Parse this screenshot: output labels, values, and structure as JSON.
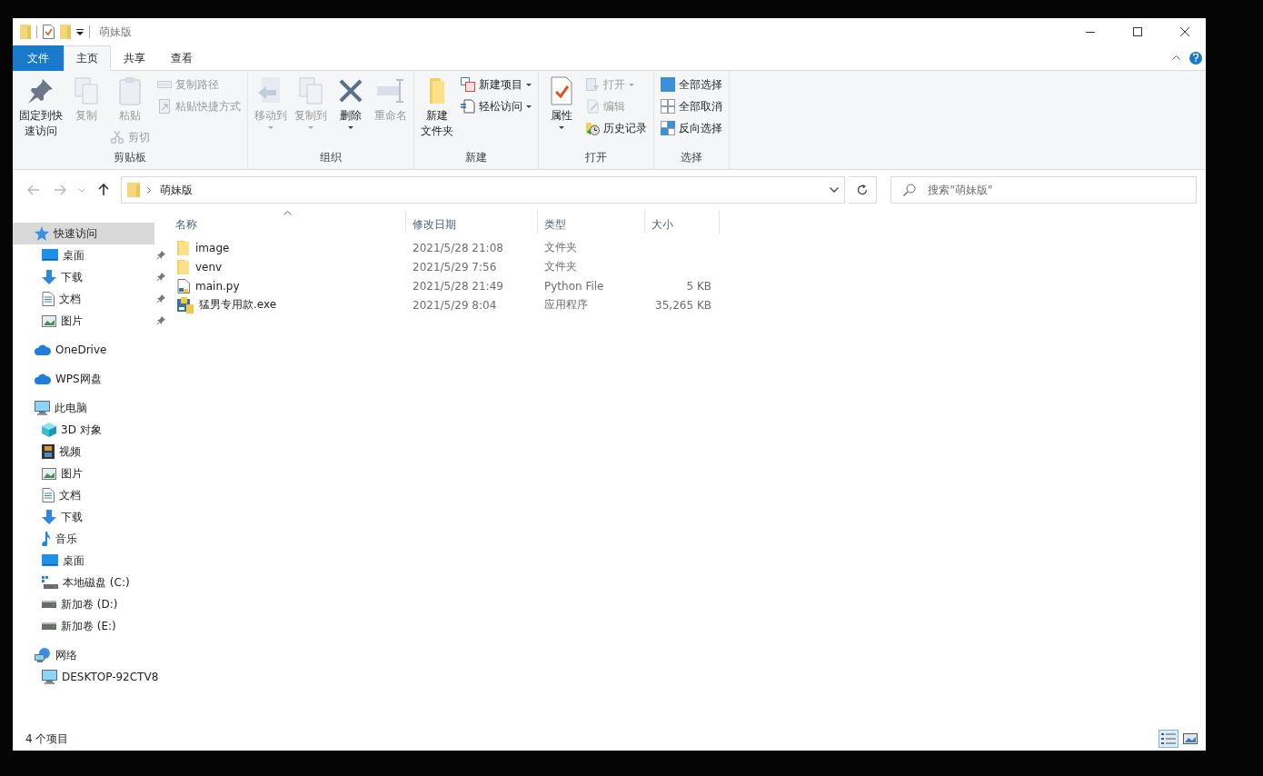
{
  "title_bar": {
    "title": "萌妹版"
  },
  "ribbon": {
    "tabs": [
      {
        "label": "文件",
        "kind": "file",
        "selected": false
      },
      {
        "label": "主页",
        "kind": "tab",
        "selected": true
      },
      {
        "label": "共享",
        "kind": "tab",
        "selected": false
      },
      {
        "label": "查看",
        "kind": "tab",
        "selected": false
      }
    ],
    "groups": [
      {
        "label": "剪贴板",
        "columns": [
          [
            {
              "label": [
                "固定到快",
                "速访问"
              ],
              "kind": "large",
              "disabled": false,
              "dropdown": false
            }
          ],
          [
            {
              "label": "复制",
              "kind": "large",
              "disabled": true,
              "dropdown": false
            }
          ],
          [
            {
              "label": "粘贴",
              "kind": "large",
              "disabled": true,
              "dropdown": false
            },
            {
              "label": "剪切",
              "kind": "small",
              "disabled": true,
              "dropdown": false
            }
          ],
          [
            {
              "label": "复制路径",
              "kind": "small",
              "disabled": true,
              "dropdown": false
            },
            {
              "label": "粘贴快捷方式",
              "kind": "small",
              "disabled": true,
              "dropdown": false
            }
          ]
        ]
      },
      {
        "label": "组织",
        "columns": [
          [
            {
              "label": "移动到",
              "kind": "large",
              "disabled": true,
              "dropdown": true
            }
          ],
          [
            {
              "label": "复制到",
              "kind": "large",
              "disabled": true,
              "dropdown": true
            }
          ],
          [
            {
              "label": "删除",
              "kind": "large",
              "disabled": false,
              "dropdown": true
            }
          ],
          [
            {
              "label": "重命名",
              "kind": "large",
              "disabled": true,
              "dropdown": false
            }
          ]
        ]
      },
      {
        "label": "新建",
        "columns": [
          [
            {
              "label": [
                "新建",
                "文件夹"
              ],
              "kind": "large",
              "disabled": false,
              "dropdown": false
            }
          ],
          [
            {
              "label": "新建项目",
              "kind": "small",
              "disabled": false,
              "dropdown": true
            },
            {
              "label": "轻松访问",
              "kind": "small",
              "disabled": false,
              "dropdown": true
            }
          ]
        ]
      },
      {
        "label": "打开",
        "columns": [
          [
            {
              "label": "属性",
              "kind": "large",
              "disabled": false,
              "dropdown": true
            }
          ],
          [
            {
              "label": "打开",
              "kind": "small",
              "disabled": true,
              "dropdown": true
            },
            {
              "label": "编辑",
              "kind": "small",
              "disabled": true,
              "dropdown": false
            },
            {
              "label": "历史记录",
              "kind": "small",
              "disabled": false,
              "dropdown": false
            }
          ]
        ]
      },
      {
        "label": "选择",
        "columns": [
          [
            {
              "label": "全部选择",
              "kind": "small",
              "disabled": false,
              "dropdown": false
            },
            {
              "label": "全部取消",
              "kind": "small",
              "disabled": false,
              "dropdown": false
            },
            {
              "label": "反向选择",
              "kind": "small",
              "disabled": false,
              "dropdown": false
            }
          ]
        ]
      }
    ]
  },
  "nav_buttons": [
    {
      "kind": "back",
      "disabled": true
    },
    {
      "kind": "forward",
      "disabled": true
    },
    {
      "kind": "recent",
      "disabled": true
    },
    {
      "kind": "up",
      "disabled": false
    }
  ],
  "address_bar": {
    "path": [
      "萌妹版"
    ]
  },
  "search": {
    "placeholder": "搜索\"萌妹版\""
  },
  "sidebar": [
    {
      "label": "快速访问",
      "kind": "star",
      "selected": true,
      "children": [
        {
          "label": "桌面",
          "kind": "desktop",
          "selected": false,
          "pinned": true
        },
        {
          "label": "下载",
          "kind": "download",
          "selected": false,
          "pinned": true
        },
        {
          "label": "文档",
          "kind": "document",
          "selected": false,
          "pinned": true
        },
        {
          "label": "图片",
          "kind": "picture",
          "selected": false,
          "pinned": true
        }
      ]
    },
    {
      "label": "OneDrive",
      "kind": "cloud",
      "selected": false
    },
    {
      "label": "WPS网盘",
      "kind": "cloud",
      "selected": false
    },
    {
      "label": "此电脑",
      "kind": "pc",
      "selected": false,
      "children": [
        {
          "label": "3D 对象",
          "kind": "cube",
          "selected": false
        },
        {
          "label": "视频",
          "kind": "video",
          "selected": false
        },
        {
          "label": "图片",
          "kind": "picture",
          "selected": false
        },
        {
          "label": "文档",
          "kind": "document",
          "selected": false
        },
        {
          "label": "下载",
          "kind": "download",
          "selected": false
        },
        {
          "label": "音乐",
          "kind": "music",
          "selected": false
        },
        {
          "label": "桌面",
          "kind": "desktop",
          "selected": false
        },
        {
          "label": "本地磁盘 (C:)",
          "kind": "system_drive",
          "selected": false
        },
        {
          "label": "新加卷 (D:)",
          "kind": "drive",
          "selected": false
        },
        {
          "label": "新加卷 (E:)",
          "kind": "drive",
          "selected": false
        }
      ]
    },
    {
      "label": "网络",
      "kind": "network",
      "selected": false,
      "children": [
        {
          "label": "DESKTOP-92CTV8",
          "kind": "pc",
          "selected": false
        }
      ]
    }
  ],
  "file_list": {
    "columns": [
      {
        "label": "名称",
        "sorted": true
      },
      {
        "label": "修改日期",
        "sorted": false
      },
      {
        "label": "类型",
        "sorted": false
      },
      {
        "label": "大小",
        "sorted": false
      }
    ],
    "rows": [
      {
        "kind": "folder",
        "name": "image",
        "modified": "2021/5/28 21:08",
        "type": "文件夹"
      },
      {
        "kind": "folder",
        "name": "venv",
        "modified": "2021/5/29 7:56",
        "type": "文件夹"
      },
      {
        "kind": "python",
        "name": "main.py",
        "modified": "2021/5/28 21:49",
        "type": "Python File",
        "size": "5 KB"
      },
      {
        "kind": "exe",
        "name": "猛男专用款.exe",
        "modified": "2021/5/29 8:04",
        "type": "应用程序",
        "size": "35,265 KB"
      }
    ]
  },
  "status_bar": {
    "item_count": "4 个项目",
    "views": [
      {
        "kind": "details",
        "selected": true
      },
      {
        "kind": "large_icons",
        "selected": false
      }
    ]
  }
}
